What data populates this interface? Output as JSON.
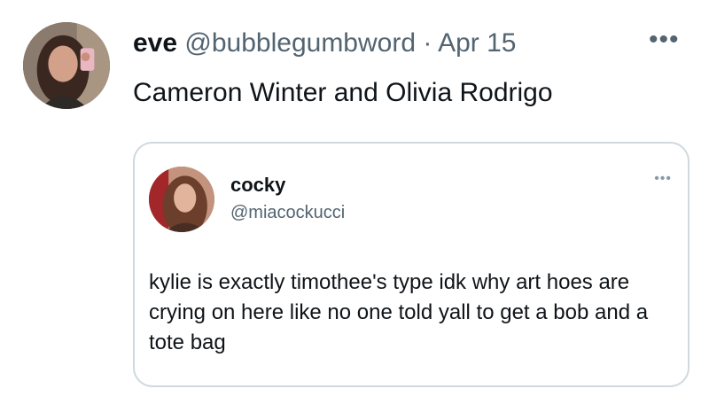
{
  "tweet": {
    "author_name": "eve",
    "author_handle": "@bubblegumbword",
    "separator": "·",
    "date": "Apr 15",
    "more_icon": "more-horizontal-icon",
    "text": "Cameron Winter and Olivia Rodrigo"
  },
  "quoted_tweet": {
    "author_name": "cocky",
    "author_handle": "@miacockucci",
    "more_icon": "more-horizontal-icon",
    "text": "kylie is exactly timothee's type idk why art hoes are crying on here like no one told yall to get a bob and a tote bag"
  },
  "colors": {
    "text_primary": "#0f1419",
    "text_secondary": "#536471",
    "border": "#cfd9de"
  }
}
